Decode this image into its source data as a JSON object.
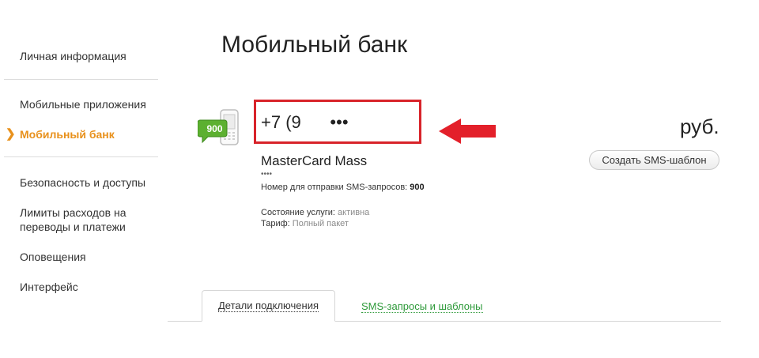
{
  "sidebar": {
    "items": [
      {
        "label": "Личная информация"
      },
      {
        "label": "Мобильные приложения"
      },
      {
        "label": "Мобильный банк",
        "active": true
      },
      {
        "label": "Безопасность и доступы"
      },
      {
        "label": "Лимиты расходов на переводы и платежи"
      },
      {
        "label": "Оповещения"
      },
      {
        "label": "Интерфейс"
      }
    ],
    "accent_color": "#e8911c"
  },
  "main": {
    "title": "Мобильный банк",
    "icon_badge": "900",
    "phone_number": "+7 (9      •••",
    "balance_unit": "руб.",
    "create_sms_button": "Создать SMS-шаблон",
    "card_name": "MasterCard Mass",
    "card_mask": "•••• ",
    "sms_number_label": "Номер для отправки SMS-запросов:",
    "sms_number": "900",
    "status_label": "Состояние услуги:",
    "status_value": "активна",
    "tariff_label": "Тариф:",
    "tariff_value": "Полный пакет",
    "highlight_color": "#d8232a"
  },
  "tabs": [
    {
      "label": "Детали подключения",
      "active": true
    },
    {
      "label": "SMS-запросы и шаблоны",
      "active": false
    }
  ]
}
